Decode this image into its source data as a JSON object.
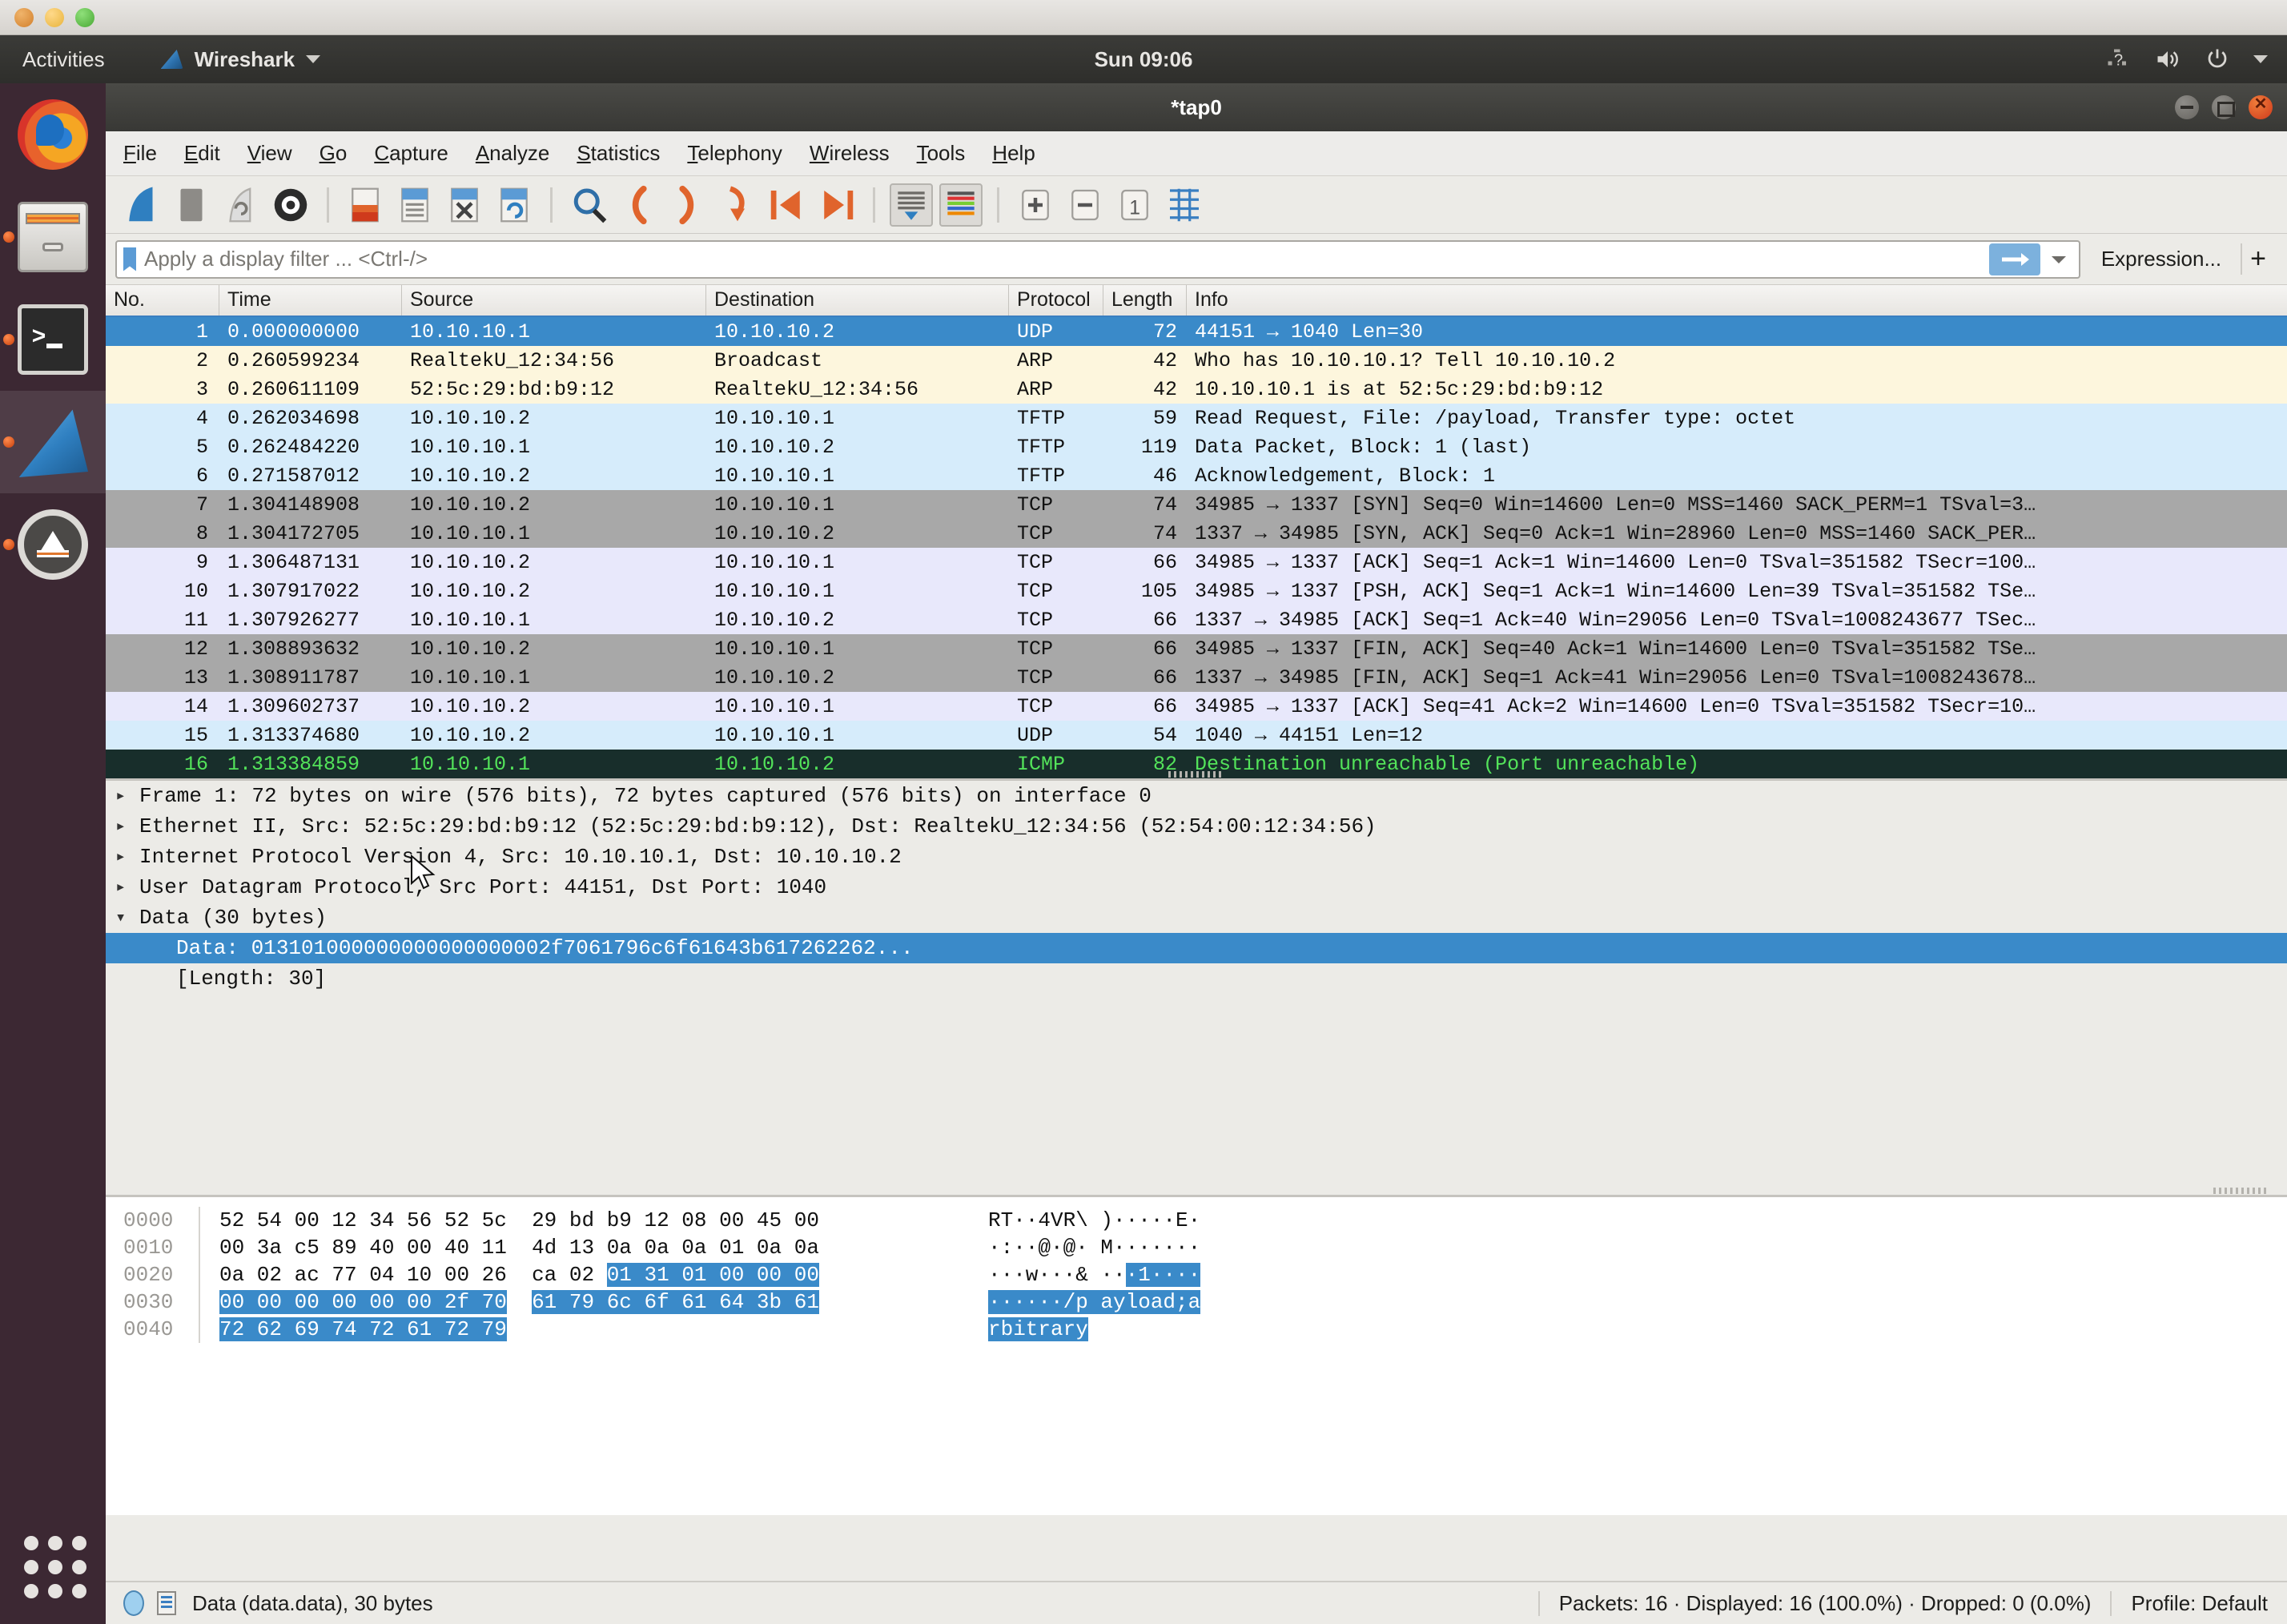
{
  "desktop": {
    "activities_label": "Activities",
    "app_menu_label": "Wireshark",
    "clock": "Sun 09:06",
    "tray_icons": [
      "accessibility-icon",
      "volume-icon",
      "power-icon",
      "chevron-down-icon"
    ],
    "dock_items": [
      {
        "name": "firefox",
        "label": "Firefox",
        "running": false,
        "active": false
      },
      {
        "name": "files",
        "label": "Files",
        "running": true,
        "active": false
      },
      {
        "name": "terminal",
        "label": "Terminal",
        "running": true,
        "active": false
      },
      {
        "name": "wireshark",
        "label": "Wireshark",
        "running": true,
        "active": true
      },
      {
        "name": "software-updater",
        "label": "Software Updater",
        "running": true,
        "active": false
      }
    ],
    "show_apps_label": "Show Applications"
  },
  "window": {
    "title": "*tap0",
    "controls": [
      "minimize",
      "maximize",
      "close"
    ]
  },
  "menubar": [
    {
      "label": "File",
      "mnemonic": "F"
    },
    {
      "label": "Edit",
      "mnemonic": "E"
    },
    {
      "label": "View",
      "mnemonic": "V"
    },
    {
      "label": "Go",
      "mnemonic": "G"
    },
    {
      "label": "Capture",
      "mnemonic": "C"
    },
    {
      "label": "Analyze",
      "mnemonic": "A"
    },
    {
      "label": "Statistics",
      "mnemonic": "S"
    },
    {
      "label": "Telephony",
      "mnemonic": "T"
    },
    {
      "label": "Wireless",
      "mnemonic": "W"
    },
    {
      "label": "Tools",
      "mnemonic": "T"
    },
    {
      "label": "Help",
      "mnemonic": "H"
    }
  ],
  "toolbar": {
    "buttons": [
      "start-capture-icon",
      "stop-capture-icon",
      "restart-capture-icon",
      "capture-options-icon",
      "open-file-icon",
      "save-file-icon",
      "close-file-icon",
      "reload-file-icon",
      "find-packet-icon",
      "go-back-icon",
      "go-forward-icon",
      "go-to-packet-icon",
      "go-first-packet-icon",
      "go-last-packet-icon",
      "auto-scroll-icon",
      "colorize-icon",
      "zoom-in-icon",
      "zoom-out-icon",
      "zoom-reset-icon",
      "resize-columns-icon"
    ]
  },
  "filter": {
    "placeholder": "Apply a display filter ... <Ctrl-/>",
    "value": "",
    "apply_icon": "arrow-right-icon",
    "dropdown_icon": "chevron-down-icon",
    "bookmark_icon": "bookmark-icon",
    "expression_label": "Expression...",
    "plus_label": "+"
  },
  "packet_list": {
    "columns": [
      "No.",
      "Time",
      "Source",
      "Destination",
      "Protocol",
      "Length",
      "Info"
    ],
    "rows": [
      {
        "no": "1",
        "time": "0.000000000",
        "src": "10.10.10.1",
        "dst": "10.10.10.2",
        "proto": "UDP",
        "len": "72",
        "info": "44151 → 1040 Len=30",
        "style": "r-sel"
      },
      {
        "no": "2",
        "time": "0.260599234",
        "src": "RealtekU_12:34:56",
        "dst": "Broadcast",
        "proto": "ARP",
        "len": "42",
        "info": "Who has 10.10.10.1? Tell 10.10.10.2",
        "style": "r-arp"
      },
      {
        "no": "3",
        "time": "0.260611109",
        "src": "52:5c:29:bd:b9:12",
        "dst": "RealtekU_12:34:56",
        "proto": "ARP",
        "len": "42",
        "info": "10.10.10.1 is at 52:5c:29:bd:b9:12",
        "style": "r-arp"
      },
      {
        "no": "4",
        "time": "0.262034698",
        "src": "10.10.10.2",
        "dst": "10.10.10.1",
        "proto": "TFTP",
        "len": "59",
        "info": "Read Request, File: /payload, Transfer type: octet",
        "style": "r-tftp"
      },
      {
        "no": "5",
        "time": "0.262484220",
        "src": "10.10.10.1",
        "dst": "10.10.10.2",
        "proto": "TFTP",
        "len": "119",
        "info": "Data Packet, Block: 1 (last)",
        "style": "r-tftp"
      },
      {
        "no": "6",
        "time": "0.271587012",
        "src": "10.10.10.2",
        "dst": "10.10.10.1",
        "proto": "TFTP",
        "len": "46",
        "info": "Acknowledgement, Block: 1",
        "style": "r-tftp"
      },
      {
        "no": "7",
        "time": "1.304148908",
        "src": "10.10.10.2",
        "dst": "10.10.10.1",
        "proto": "TCP",
        "len": "74",
        "info": "34985 → 1337 [SYN] Seq=0 Win=14600 Len=0 MSS=1460 SACK_PERM=1 TSval=3…",
        "style": "r-tcpg"
      },
      {
        "no": "8",
        "time": "1.304172705",
        "src": "10.10.10.1",
        "dst": "10.10.10.2",
        "proto": "TCP",
        "len": "74",
        "info": "1337 → 34985 [SYN, ACK] Seq=0 Ack=1 Win=28960 Len=0 MSS=1460 SACK_PER…",
        "style": "r-tcpg"
      },
      {
        "no": "9",
        "time": "1.306487131",
        "src": "10.10.10.2",
        "dst": "10.10.10.1",
        "proto": "TCP",
        "len": "66",
        "info": "34985 → 1337 [ACK] Seq=1 Ack=1 Win=14600 Len=0 TSval=351582 TSecr=100…",
        "style": "r-tcpl"
      },
      {
        "no": "10",
        "time": "1.307917022",
        "src": "10.10.10.2",
        "dst": "10.10.10.1",
        "proto": "TCP",
        "len": "105",
        "info": "34985 → 1337 [PSH, ACK] Seq=1 Ack=1 Win=14600 Len=39 TSval=351582 TSe…",
        "style": "r-tcpl"
      },
      {
        "no": "11",
        "time": "1.307926277",
        "src": "10.10.10.1",
        "dst": "10.10.10.2",
        "proto": "TCP",
        "len": "66",
        "info": "1337 → 34985 [ACK] Seq=1 Ack=40 Win=29056 Len=0 TSval=1008243677 TSec…",
        "style": "r-tcpl"
      },
      {
        "no": "12",
        "time": "1.308893632",
        "src": "10.10.10.2",
        "dst": "10.10.10.1",
        "proto": "TCP",
        "len": "66",
        "info": "34985 → 1337 [FIN, ACK] Seq=40 Ack=1 Win=14600 Len=0 TSval=351582 TSe…",
        "style": "r-tcpg"
      },
      {
        "no": "13",
        "time": "1.308911787",
        "src": "10.10.10.1",
        "dst": "10.10.10.2",
        "proto": "TCP",
        "len": "66",
        "info": "1337 → 34985 [FIN, ACK] Seq=1 Ack=41 Win=29056 Len=0 TSval=1008243678…",
        "style": "r-tcpg"
      },
      {
        "no": "14",
        "time": "1.309602737",
        "src": "10.10.10.2",
        "dst": "10.10.10.1",
        "proto": "TCP",
        "len": "66",
        "info": "34985 → 1337 [ACK] Seq=41 Ack=2 Win=14600 Len=0 TSval=351582 TSecr=10…",
        "style": "r-tcpl"
      },
      {
        "no": "15",
        "time": "1.313374680",
        "src": "10.10.10.2",
        "dst": "10.10.10.1",
        "proto": "UDP",
        "len": "54",
        "info": "1040 → 44151 Len=12",
        "style": "r-udp"
      },
      {
        "no": "16",
        "time": "1.313384859",
        "src": "10.10.10.1",
        "dst": "10.10.10.2",
        "proto": "ICMP",
        "len": "82",
        "info": "Destination unreachable (Port unreachable)",
        "style": "r-icmp"
      }
    ]
  },
  "packet_details": {
    "rows": [
      {
        "tri": "▸",
        "text": "Frame 1: 72 bytes on wire (576 bits), 72 bytes captured (576 bits) on interface 0",
        "selected": false,
        "child": false
      },
      {
        "tri": "▸",
        "text": "Ethernet II, Src: 52:5c:29:bd:b9:12 (52:5c:29:bd:b9:12), Dst: RealtekU_12:34:56 (52:54:00:12:34:56)",
        "selected": false,
        "child": false
      },
      {
        "tri": "▸",
        "text": "Internet Protocol Version 4, Src: 10.10.10.1, Dst: 10.10.10.2",
        "selected": false,
        "child": false
      },
      {
        "tri": "▸",
        "text": "User Datagram Protocol, Src Port: 44151, Dst Port: 1040",
        "selected": false,
        "child": false
      },
      {
        "tri": "▾",
        "text": "Data (30 bytes)",
        "selected": false,
        "child": false
      },
      {
        "tri": "",
        "text": "Data: 013101000000000000000002f7061796c6f61643b617262262...",
        "selected": true,
        "child": true
      },
      {
        "tri": "",
        "text": "[Length: 30]",
        "selected": false,
        "child": true
      }
    ]
  },
  "hex_dump": {
    "rows": [
      {
        "offset": "0000",
        "bytes_plain_1": "52 54 00 12 34 56 52 5c",
        "bytes_plain_2": "29 bd b9 12 08 00 45 00",
        "bytes_hl_2": "",
        "ascii_plain": "RT··4VR\\ )·····E·",
        "ascii_hl": ""
      },
      {
        "offset": "0010",
        "bytes_plain_1": "00 3a c5 89 40 00 40 11",
        "bytes_plain_2": "4d 13 0a 0a 0a 01 0a 0a",
        "bytes_hl_2": "",
        "ascii_plain": "·:··@·@· M·······",
        "ascii_hl": ""
      },
      {
        "offset": "0020",
        "bytes_plain_1": "0a 02 ac 77 04 10 00 26",
        "bytes_plain_2": "ca 02 ",
        "bytes_hl_2": "01 31 01 00 00 00",
        "ascii_plain": "···w···& ··",
        "ascii_hl": "·1····"
      },
      {
        "offset": "0030",
        "bytes_plain_1": "",
        "bytes_hl_1": "00 00 00 00 00 00 2f 70",
        "bytes_hl_2": "61 79 6c 6f 61 64 3b 61",
        "ascii_plain": "",
        "ascii_hl": "······/p ayload;a"
      },
      {
        "offset": "0040",
        "bytes_plain_1": "",
        "bytes_hl_1": "72 62 69 74 72 61 72 79",
        "bytes_hl_2": "",
        "ascii_plain": "",
        "ascii_hl": "rbitrary"
      }
    ]
  },
  "statusbar": {
    "field_text": "Data (data.data), 30 bytes",
    "packets_text": "Packets: 16 · Displayed: 16 (100.0%) · Dropped: 0 (0.0%)",
    "profile_text": "Profile: Default",
    "expert_icon": "expert-info-icon",
    "capture_file_icon": "capture-file-properties-icon"
  },
  "colors": {
    "selection_blue": "#3a8ac9",
    "arp_row": "#fdf6dd",
    "udp_row": "#d6ecfb",
    "tcp_gray": "#a8a8a8",
    "tcp_light": "#e8e8fb",
    "icmp_dark": "#182e2b",
    "icmp_text": "#53e35a",
    "window_bg": "#ecebe7",
    "dock_bg": "#3c2833"
  }
}
